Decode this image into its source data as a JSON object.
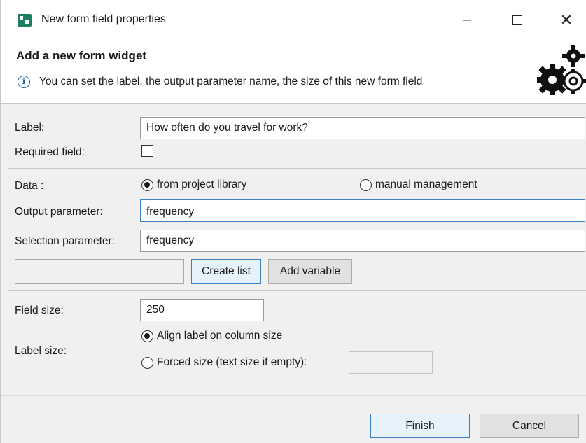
{
  "window": {
    "title": "New form field properties",
    "controls": {
      "minimize": "—",
      "maximize": "□",
      "close": "✕"
    }
  },
  "header": {
    "title": "Add a new form widget",
    "info_icon": "info-icon",
    "description": "You can set the label, the output parameter name, the size of this new form field",
    "banner_icon": "gears-icon"
  },
  "form": {
    "label": {
      "caption": "Label:",
      "value": "How often do you travel for work?"
    },
    "required": {
      "caption": "Required field:",
      "checked": false
    },
    "data": {
      "caption": "Data :",
      "options": [
        {
          "label": "from project library",
          "selected": true
        },
        {
          "label": "manual management",
          "selected": false
        }
      ]
    },
    "output_parameter": {
      "caption": "Output parameter:",
      "value": "frequency"
    },
    "selection_parameter": {
      "caption": "Selection parameter:",
      "value": "frequency"
    },
    "list_name": {
      "value": ""
    },
    "create_list_label": "Create list",
    "add_variable_label": "Add variable",
    "field_size": {
      "caption": "Field size:",
      "value": "250"
    },
    "label_size": {
      "caption": "Label size:",
      "options": [
        {
          "label": "Align label on column size",
          "selected": true
        },
        {
          "label": "Forced size (text size if empty):",
          "selected": false
        }
      ],
      "forced_value": ""
    }
  },
  "footer": {
    "finish_label": "Finish",
    "cancel_label": "Cancel"
  },
  "colors": {
    "accent": "#3b82c4",
    "app_icon": "#1b7f63",
    "dialog_bg": "#f0f0f0"
  }
}
